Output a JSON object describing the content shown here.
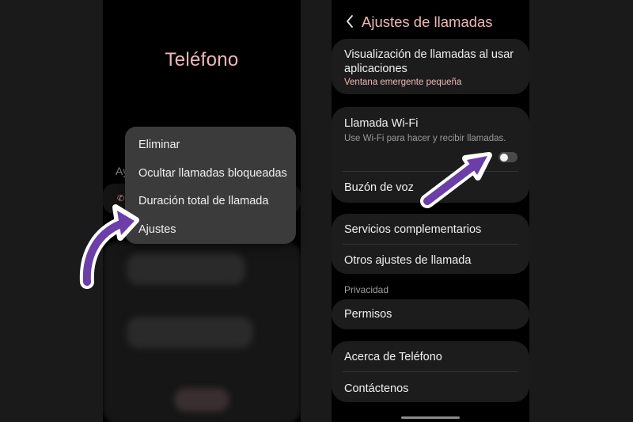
{
  "left_phone": {
    "app_title": "Teléfono",
    "section_peek": "Ay",
    "menu": {
      "items": [
        {
          "label": "Eliminar"
        },
        {
          "label": "Ocultar llamadas bloqueadas"
        },
        {
          "label": "Duración total de llamada"
        },
        {
          "label": "Ajustes"
        }
      ]
    }
  },
  "right_phone": {
    "header": {
      "title": "Ajustes de llamadas",
      "back_icon": "chevron-left-icon"
    },
    "display_on_apps": {
      "label": "Visualización de llamadas al usar aplicaciones",
      "value": "Ventana emergente pequeña"
    },
    "wifi_call": {
      "label": "Llamada Wi-Fi",
      "description": "Use Wi-Fi para hacer y recibir llamadas.",
      "enabled": false
    },
    "voicemail": {
      "label": "Buzón de voz"
    },
    "supplementary": {
      "label": "Servicios complementarios"
    },
    "other_settings": {
      "label": "Otros ajustes de llamada"
    },
    "privacy_section": "Privacidad",
    "permissions": {
      "label": "Permisos"
    },
    "about": {
      "label": "Acerca de Teléfono"
    },
    "contact": {
      "label": "Contáctenos"
    }
  },
  "colors": {
    "accent_pink": "#f1b7b7",
    "arrow_purple": "#6b3ea8",
    "card_bg": "#1c1c1c",
    "menu_bg": "#3b3b3b"
  }
}
